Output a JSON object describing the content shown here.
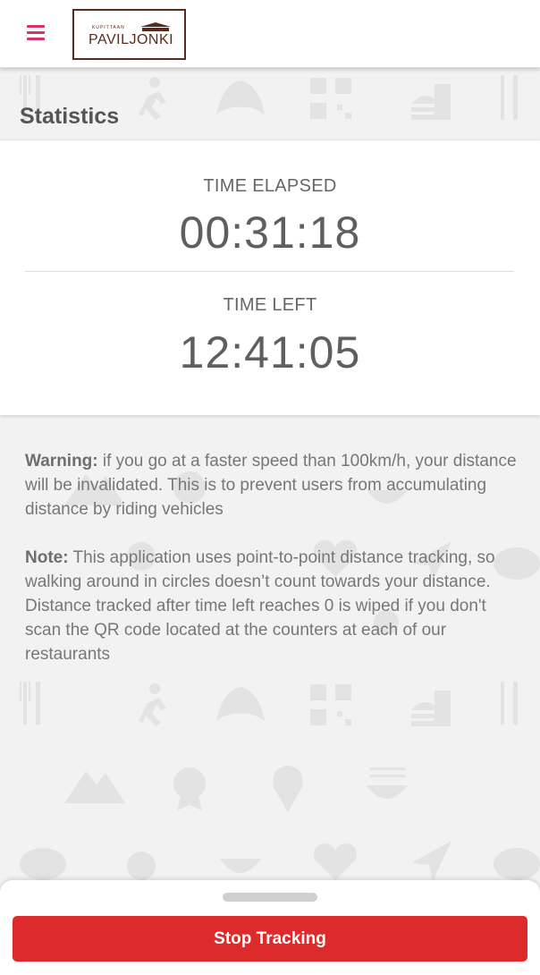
{
  "header": {
    "menu_icon": "hamburger-menu-icon",
    "logo_small_text": "KUPITTAAN",
    "logo_main_text": "PAVILJONKI",
    "menu_color": "#d6336c",
    "logo_color": "#5a2a1c"
  },
  "statistics": {
    "title": "Statistics",
    "time_elapsed_label": "TIME ELAPSED",
    "time_elapsed_value": "00:31:18",
    "time_left_label": "TIME LEFT",
    "time_left_value": "12:41:05"
  },
  "notes": {
    "warning_label": "Warning:",
    "warning_text": " if you go at a faster speed than 100km/h, your distance will be invalidated. This is to prevent users from accumulating distance by riding vehicles",
    "note_label": "Note:",
    "note_text": " This application uses point-to-point distance tracking, so walking around in circles doesn’t count towards your distance. Distance tracked after time left reaches 0 is wiped if you don't scan the QR code located at the counters at each of our restaurants"
  },
  "bottom_sheet": {
    "stop_button_label": "Stop Tracking",
    "button_color": "#dd2a2a"
  },
  "background_icons": [
    "cutlery-icon",
    "running-icon",
    "croissant-icon",
    "qr-code-icon",
    "burger-drink-icon",
    "mountain-icon",
    "award-icon",
    "location-pin-icon",
    "noodle-bowl-icon",
    "steak-icon",
    "apple-icon",
    "rice-bowl-icon",
    "heart-pulse-icon",
    "navigation-arrow-icon"
  ]
}
